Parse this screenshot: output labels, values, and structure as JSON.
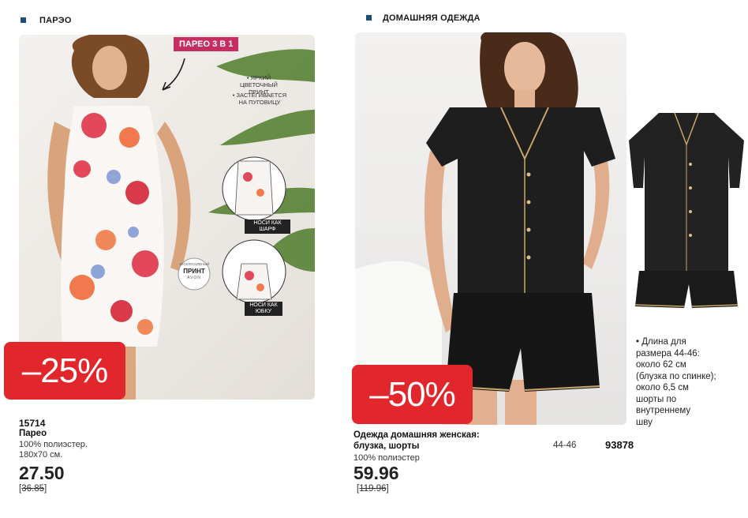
{
  "left": {
    "section_title": "ПАРЭО",
    "badge": "ПАРЕО 3 В 1",
    "callouts": [
      "• ЯРКИЙ ЦВЕТОЧНЫЙ ПРИНТ",
      "• ЗАСТЕГИВАЕТСЯ НА ПУГОВИЦУ"
    ],
    "wear_scarf": "НОСИ КАК ШАРФ",
    "wear_skirt": "НОСИ КАК ЮБКУ",
    "seal": {
      "top": "ЭКСКЛЮЗИВНЫЙ",
      "main": "ПРИНТ",
      "brand": "AVON"
    },
    "discount": "–25%",
    "sku": "15714",
    "name": "Парео",
    "desc1": "100% полиэстер.",
    "desc2": "180х70 см.",
    "price": "27.50",
    "old_price": "36.85"
  },
  "right": {
    "section_title": "ДОМАШНЯЯ ОДЕЖДА",
    "discount": "–50%",
    "name1": "Одежда домашняя женская:",
    "name2": "блузка, шорты",
    "desc": "100% полиэстер",
    "size": "44-46",
    "sku": "93878",
    "price": "59.96",
    "old_price": "119.96",
    "note": [
      "• Длина для",
      "размера 44-46:",
      "около 62 см",
      "(блузка по спинке);",
      "около 6,5 см",
      "шорты по",
      "внутреннему",
      "шву"
    ]
  },
  "colors": {
    "accent_square": "#1d4f78",
    "discount_red": "#e1262c",
    "badge_pink": "#c62e63"
  }
}
